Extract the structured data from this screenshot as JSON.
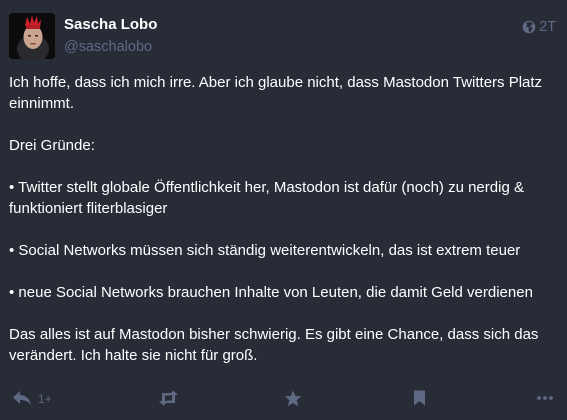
{
  "status": {
    "author": {
      "display_name": "Sascha Lobo",
      "handle": "@saschalobo",
      "avatar_icon": "avatar-image"
    },
    "visibility_icon": "globe-icon",
    "timestamp": "2T",
    "paragraphs": [
      "Ich hoffe, dass ich mich irre. Aber ich glaube nicht, dass Mastodon Twitters Platz einnimmt.",
      "Drei Gründe:",
      "• Twitter stellt globale Öffentlichkeit her, Mastodon ist dafür (noch) zu nerdig & funktioniert fliterblasiger",
      "• Social Networks müssen sich ständig weiterentwickeln, das ist extrem teuer",
      "• neue Social Networks brauchen Inhalte von Leuten, die damit Geld verdienen",
      "Das alles ist auf Mastodon bisher schwierig. Es gibt eine Chance, dass sich das verändert. Ich halte sie nicht für groß."
    ],
    "actions": {
      "reply_count": "1+",
      "reply_icon": "reply-icon",
      "boost_icon": "boost-icon",
      "favourite_icon": "star-icon",
      "bookmark_icon": "bookmark-icon",
      "more_icon": "more-icon"
    }
  },
  "colors": {
    "background": "#282c37",
    "text": "#ffffff",
    "muted": "#606984",
    "avatar_hair": "#d0202a"
  }
}
